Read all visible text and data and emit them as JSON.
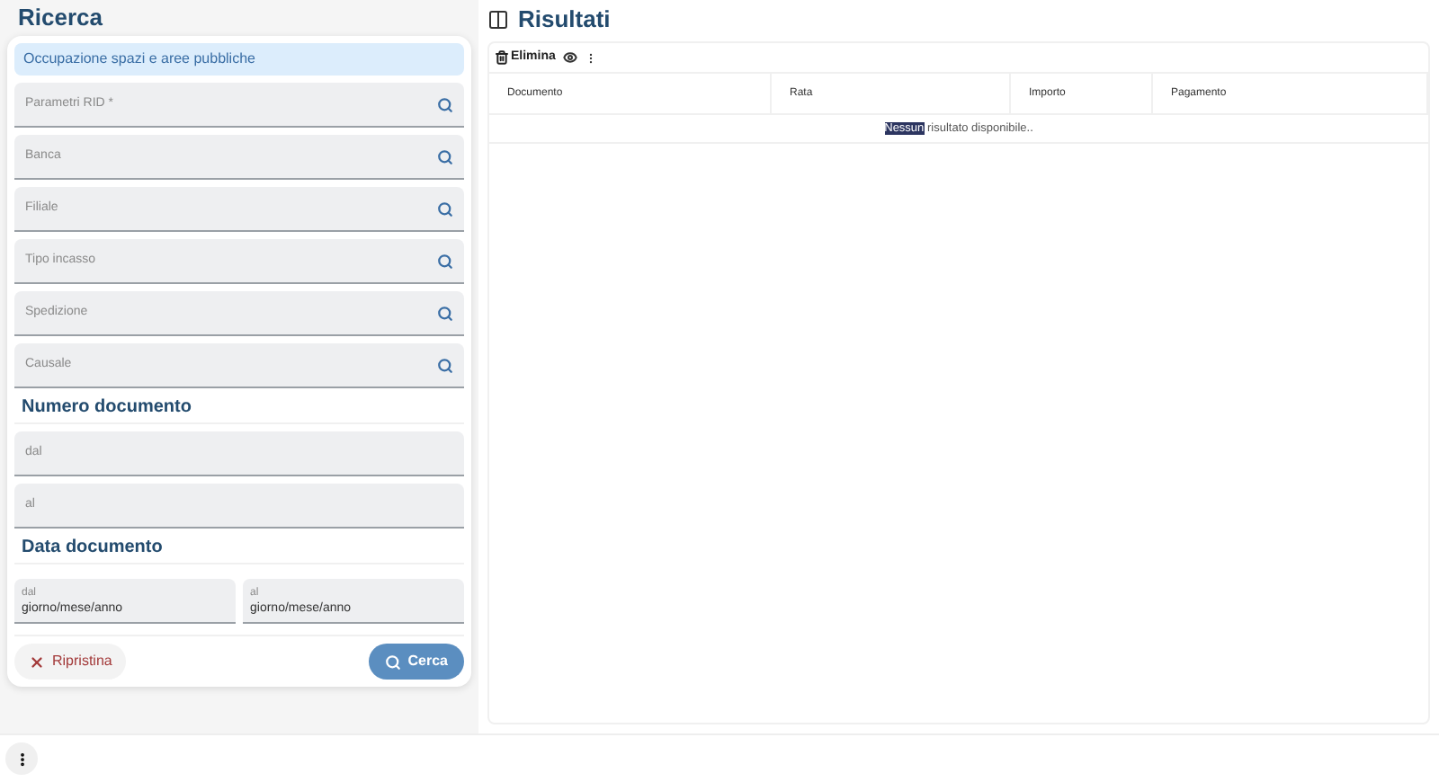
{
  "search_panel": {
    "title": "Ricerca",
    "category": "Occupazione spazi e aree pubbliche",
    "lookup_fields": [
      {
        "placeholder": "Parametri RID *"
      },
      {
        "placeholder": "Banca"
      },
      {
        "placeholder": "Filiale"
      },
      {
        "placeholder": "Tipo incasso"
      },
      {
        "placeholder": "Spedizione"
      },
      {
        "placeholder": "Causale"
      }
    ],
    "number_section": {
      "title": "Numero documento",
      "fields": [
        {
          "placeholder": "dal"
        },
        {
          "placeholder": "al"
        }
      ]
    },
    "date_section": {
      "title": "Data documento",
      "fields": [
        {
          "label": "dal",
          "placeholder": "giorno/mese/anno"
        },
        {
          "label": "al",
          "placeholder": "giorno/mese/anno"
        }
      ]
    },
    "reset_button": "Ripristina",
    "search_button": "Cerca"
  },
  "results": {
    "title": "Risultati",
    "toolbar": {
      "delete_button": "Elimina"
    },
    "columns": [
      "Documento",
      "Rata",
      "Importo",
      "Pagamento"
    ],
    "empty_message": {
      "selected": "Nessun",
      "rest": " risultato disponibile.."
    }
  }
}
